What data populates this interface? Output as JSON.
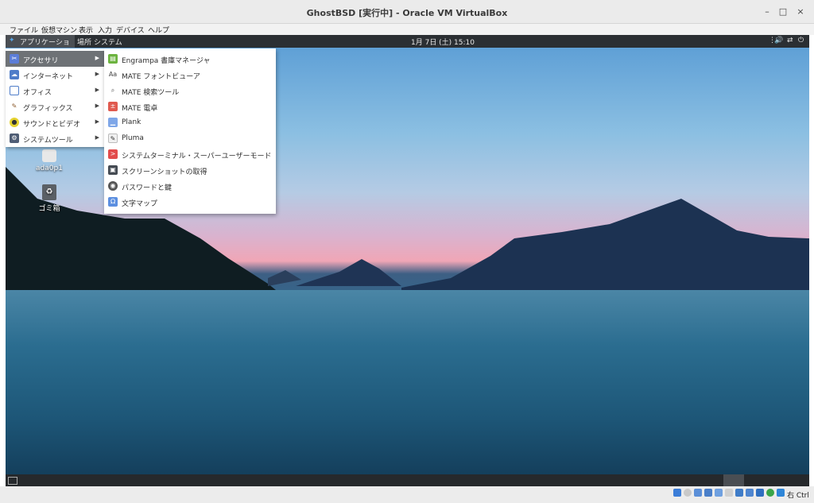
{
  "window": {
    "title": "GhostBSD [実行中] - Oracle VM VirtualBox",
    "minimize": "–",
    "maximize": "□",
    "close": "×"
  },
  "menubar": [
    "ファイル",
    "仮想マシン",
    "表示",
    "入力",
    "デバイス",
    "ヘルプ"
  ],
  "panel": {
    "applications": "アプリケーション",
    "places": "場所",
    "system": "システム",
    "clock": "1月 7日 (土) 15:10"
  },
  "app_menu": [
    {
      "label": "アクセサリ",
      "icon": "accessories-icon",
      "color": "#5b7dd8"
    },
    {
      "label": "インターネット",
      "icon": "cloud-icon",
      "color": "#4f7dc9"
    },
    {
      "label": "オフィス",
      "icon": "document-icon",
      "color": "#ffffff"
    },
    {
      "label": "グラフィックス",
      "icon": "pencil-icon",
      "color": "#d9a441"
    },
    {
      "label": "サウンドとビデオ",
      "icon": "speaker-icon",
      "color": "#e5d22f"
    },
    {
      "label": "システムツール",
      "icon": "gear-icon",
      "color": "#4f5d75"
    }
  ],
  "accessories_menu": [
    {
      "label": "Engrampa 書庫マネージャ",
      "icon": "archive-icon",
      "color": "#6cb33f"
    },
    {
      "label": "MATE フォントビューア",
      "icon": "font-icon",
      "color": "#ffffff"
    },
    {
      "label": "MATE 検索ツール",
      "icon": "search-icon",
      "color": "#ffffff"
    },
    {
      "label": "MATE 電卓",
      "icon": "calculator-icon",
      "color": "#e05a4f"
    },
    {
      "label": "Plank",
      "icon": "dock-icon",
      "color": "#7fa7e8"
    },
    {
      "label": "Pluma",
      "icon": "text-editor-icon",
      "color": "#f1f1f1"
    },
    {
      "label": "システムターミナル・スーパーユーザーモード",
      "icon": "terminal-icon",
      "color": "#e24c4c"
    },
    {
      "label": "スクリーンショットの取得",
      "icon": "screenshot-icon",
      "color": "#444a52"
    },
    {
      "label": "パスワードと鍵",
      "icon": "keyring-icon",
      "color": "#555555"
    },
    {
      "label": "文字マップ",
      "icon": "charmap-icon",
      "color": "#5c8fe0"
    }
  ],
  "desktop_icons": [
    {
      "label": "ada0p1",
      "icon": "drive-icon"
    },
    {
      "label": "ゴミ箱",
      "icon": "trash-icon"
    }
  ],
  "status": {
    "host_key": "右 Ctrl"
  }
}
